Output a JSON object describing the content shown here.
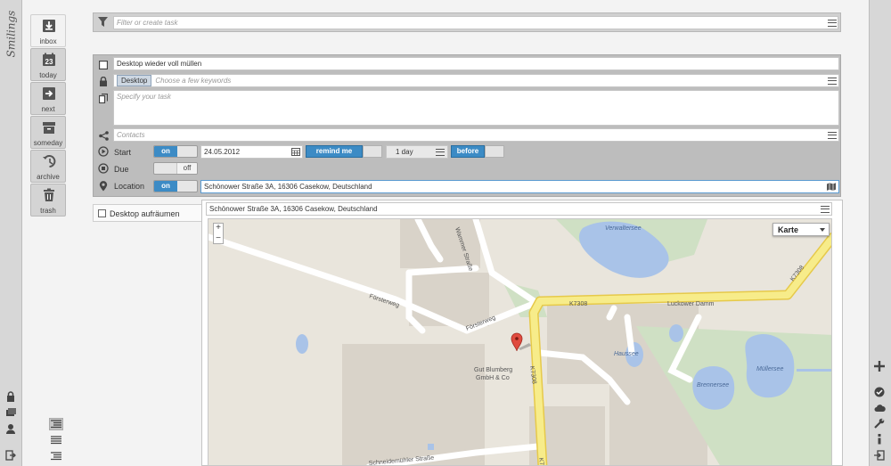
{
  "app": {
    "logo_text": "Smilings",
    "colors": {
      "accent": "#3c8bc5",
      "panel": "#bdbdbd",
      "map_road": "#ffffff",
      "map_highway": "#f7ec8a",
      "map_water": "#a9c3e8"
    }
  },
  "left_sidebar": {
    "icons": [
      "lock-icon",
      "folders-icon",
      "user-icon",
      "logout-icon"
    ]
  },
  "nav": {
    "items": [
      {
        "label": "inbox",
        "icon": "inbox-icon",
        "active": true
      },
      {
        "label": "today",
        "icon": "calendar-icon",
        "day": "23",
        "active": false
      },
      {
        "label": "next",
        "icon": "next-icon",
        "active": false
      },
      {
        "label": "someday",
        "icon": "box-icon",
        "active": false
      },
      {
        "label": "archive",
        "icon": "history-icon",
        "active": false
      },
      {
        "label": "trash",
        "icon": "trash-icon",
        "active": false
      }
    ],
    "view_buttons": [
      "list-view-icon",
      "compact-view-icon",
      "indent-view-icon"
    ]
  },
  "right_sidebar": {
    "icons": [
      "plus-icon",
      "checkmark-icon",
      "cloud-icon",
      "wrench-icon",
      "info-icon",
      "login-icon"
    ]
  },
  "filter": {
    "placeholder": "Filter or create task"
  },
  "task": {
    "title": "Desktop wieder voll müllen",
    "tags": [
      "Desktop"
    ],
    "keywords_placeholder": "Choose a few keywords",
    "description_placeholder": "Specify your task",
    "contacts_placeholder": "Contacts",
    "start": {
      "label": "Start",
      "toggle": "on",
      "date": "24.05.2012",
      "remind_label": "remind me",
      "remind_value": "1 day",
      "before_label": "before"
    },
    "due": {
      "label": "Due",
      "toggle": "off"
    },
    "location": {
      "label": "Location",
      "toggle": "on",
      "value": "Schönower Straße 3A, 16306 Casekow, Deutschland"
    }
  },
  "second_task": {
    "title": "Desktop aufräumen"
  },
  "map_panel": {
    "address": "Schönower Straße 3A, 16306 Casekow, Deutschland",
    "map_type": "Karte",
    "zoom_in": "+",
    "zoom_out": "−",
    "labels": {
      "verwaltersee": "Verwaltersee",
      "wammer_strasse": "Wammer Straße",
      "foersterweg_1": "Försterweg",
      "foersterweg_2": "Försterweg",
      "k7308_a": "K7308",
      "k7308_b": "K7308",
      "k7308_c": "K7308",
      "k7308_d": "K7308",
      "luckower_damm": "Luckower Damm",
      "haussee": "Haussee",
      "muellersee": "Müllersee",
      "brennersee": "Brennersee",
      "gut_blumberg_1": "Gut Blumberg",
      "gut_blumberg_2": "GmbH & Co",
      "schneidemuehler": "Schneidemühler Straße"
    }
  }
}
